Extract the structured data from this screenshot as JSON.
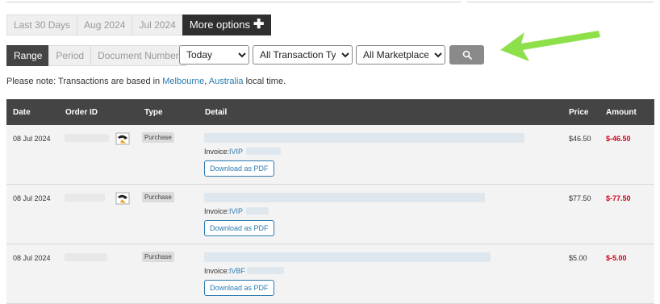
{
  "quick_ranges": [
    "Last 30 Days",
    "Aug 2024",
    "Jul 2024"
  ],
  "more_options_label": "More options",
  "filter_modes": [
    "Range",
    "Period",
    "Document Number"
  ],
  "date_select": {
    "selected": "Today"
  },
  "type_select": {
    "selected": "All Transaction Types"
  },
  "marketplace_select": {
    "selected": "All Marketplaces"
  },
  "note": {
    "prefix": "Please note: Transactions are based in",
    "city": "Melbourne",
    "comma": ",",
    "country": "Australia",
    "suffix": "local time."
  },
  "table": {
    "headers": {
      "date": "Date",
      "order_id": "Order ID",
      "type": "Type",
      "detail": "Detail",
      "price": "Price",
      "amount": "Amount"
    },
    "rows": [
      {
        "date": "08 Jul 2024",
        "type": "Purchase",
        "invoice_label": "Invoice:",
        "invoice_prefix": "IVIP",
        "download": "Download as PDF",
        "price": "$46.50",
        "amount": "$-46.50"
      },
      {
        "date": "08 Jul 2024",
        "type": "Purchase",
        "invoice_label": "Invoice:",
        "invoice_prefix": "IVIP",
        "download": "Download as PDF",
        "price": "$77.50",
        "amount": "$-77.50"
      },
      {
        "date": "08 Jul 2024",
        "type": "Purchase",
        "invoice_label": "Invoice:",
        "invoice_prefix": "IVBF",
        "download": "Download as PDF",
        "price": "$5.00",
        "amount": "$-5.00"
      }
    ]
  },
  "colors": {
    "accent": "#2a7ab0",
    "negative": "#d0021b",
    "arrow": "#8ee04a",
    "header_bg": "#444444"
  },
  "icons": {
    "search": "search-icon",
    "plus": "plus-icon",
    "marketplace": "marketplace-logo-icon"
  }
}
